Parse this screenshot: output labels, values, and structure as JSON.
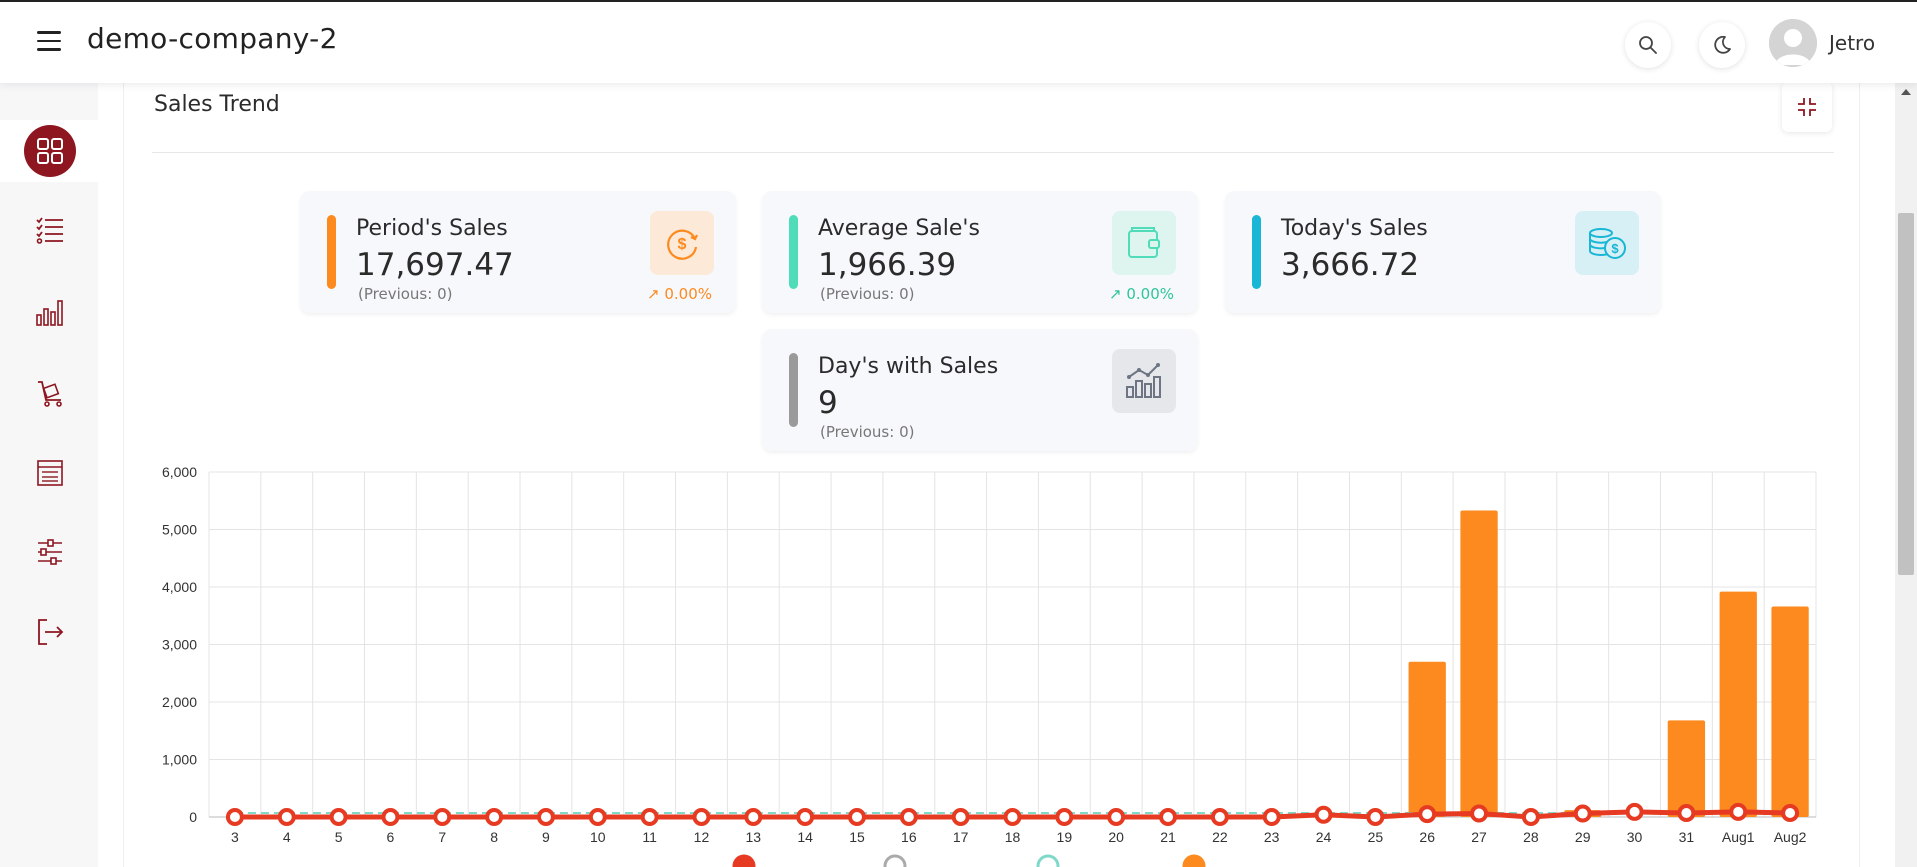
{
  "header": {
    "menu_icon": "hamburger-icon",
    "brand": "demo-company-2",
    "search_icon": "search-icon",
    "theme_icon": "moon-icon",
    "user_name": "Jetro"
  },
  "sidebar": {
    "items": [
      {
        "name": "dashboard",
        "icon": "grid-icon",
        "active": true
      },
      {
        "name": "checklist",
        "icon": "checklist-icon"
      },
      {
        "name": "reports",
        "icon": "bar-chart-icon"
      },
      {
        "name": "inventory",
        "icon": "cart-icon"
      },
      {
        "name": "records",
        "icon": "list-icon"
      },
      {
        "name": "settings",
        "icon": "sliders-icon"
      },
      {
        "name": "logout",
        "icon": "logout-icon"
      }
    ]
  },
  "section": {
    "title": "Sales Trend",
    "collapse_icon": "collapse-icon"
  },
  "kpis": [
    {
      "label": "Period's Sales",
      "value": "17,697.47",
      "previous": "(Previous: 0)",
      "change": "0.00%",
      "accent": "#fd8a1f",
      "icon": "dollar-cycle-icon",
      "icon_bg": "#fde9d7"
    },
    {
      "label": "Average Sale's",
      "value": "1,966.39",
      "previous": "(Previous: 0)",
      "change": "0.00%",
      "accent": "#4fdcb8",
      "icon": "wallet-icon",
      "icon_bg": "#ddf5ee"
    },
    {
      "label": "Today's Sales",
      "value": "3,666.72",
      "accent": "#19b6d6",
      "icon": "coins-icon",
      "icon_bg": "#d7f0f6"
    },
    {
      "label": "Day's with Sales",
      "value": "9",
      "previous": "(Previous: 0)",
      "accent": "#9a9a9a",
      "icon": "chart-icon",
      "icon_bg": "#e6e7ea"
    }
  ],
  "chart_data": {
    "type": "bar",
    "categories": [
      "3",
      "4",
      "5",
      "6",
      "7",
      "8",
      "9",
      "10",
      "11",
      "12",
      "13",
      "14",
      "15",
      "16",
      "17",
      "18",
      "19",
      "20",
      "21",
      "22",
      "23",
      "24",
      "25",
      "26",
      "27",
      "28",
      "29",
      "30",
      "31",
      "Aug1",
      "Aug2"
    ],
    "series": [
      {
        "values": [
          0,
          0,
          0,
          0,
          0,
          0,
          0,
          0,
          0,
          0,
          0,
          0,
          0,
          0,
          0,
          0,
          0,
          0,
          0,
          0,
          0,
          0,
          0,
          2700,
          5330,
          0,
          120,
          0,
          1680,
          3920,
          3660
        ],
        "type": "bar",
        "color": "#fd8a1f"
      },
      {
        "values": [
          0,
          0,
          0,
          0,
          0,
          0,
          0,
          0,
          0,
          0,
          0,
          0,
          0,
          0,
          0,
          0,
          0,
          0,
          0,
          0,
          0,
          40,
          0,
          50,
          60,
          0,
          60,
          90,
          70,
          90,
          70
        ],
        "type": "line",
        "color": "#e63a22"
      }
    ],
    "ylim": [
      0,
      6000
    ],
    "yticks": [
      "0",
      "1,000",
      "2,000",
      "3,000",
      "4,000",
      "5,000",
      "6,000"
    ],
    "grid": true
  }
}
